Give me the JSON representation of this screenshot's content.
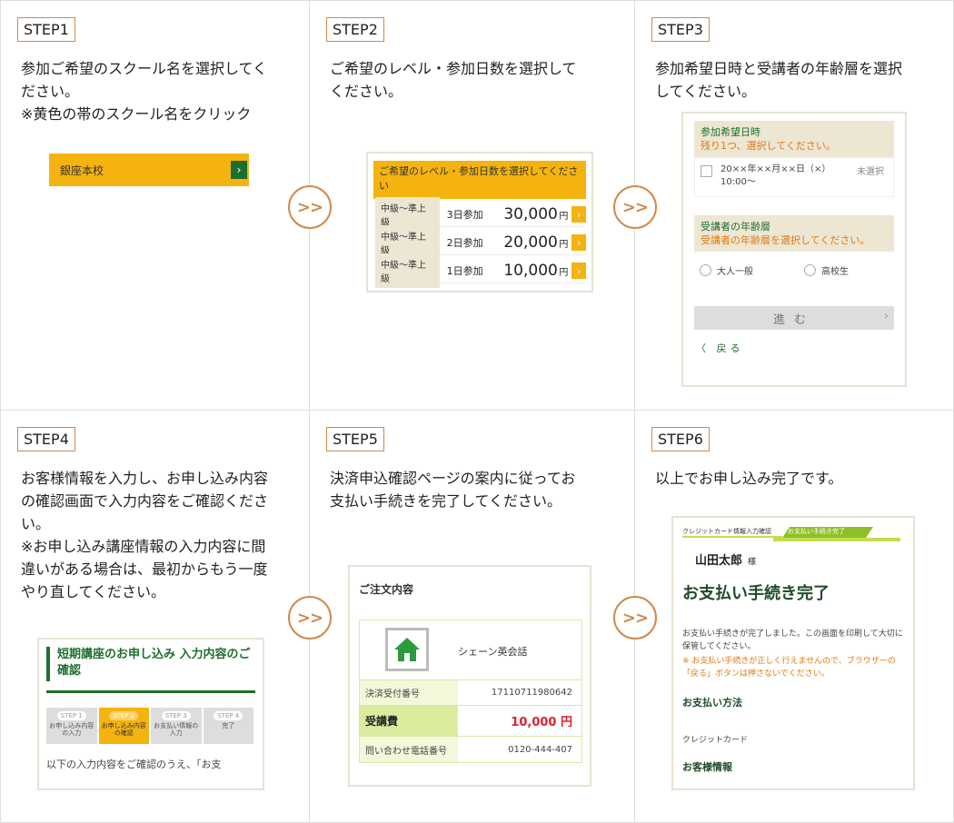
{
  "steps": [
    {
      "tag": "STEP1",
      "desc": [
        "参加ご希望のスクール名を選択してく",
        "ださい。",
        "※黄色の帯のスクール名をクリック"
      ]
    },
    {
      "tag": "STEP2",
      "desc": [
        "ご希望のレベル・参加日数を選択して",
        "ください。"
      ]
    },
    {
      "tag": "STEP3",
      "desc": [
        "参加希望日時と受講者の年齢層を選択",
        "してください。"
      ]
    },
    {
      "tag": "STEP4",
      "desc": [
        "お客様情報を入力し、お申し込み内容",
        "の確認画面で入力内容をご確認くださ",
        "い。",
        "※お申し込み講座情報の入力内容に間",
        "違いがある場合は、最初からもう一度",
        "やり直してください。"
      ]
    },
    {
      "tag": "STEP5",
      "desc": [
        "決済申込確認ページの案内に従ってお",
        "支払い手続きを完了してください。"
      ]
    },
    {
      "tag": "STEP6",
      "desc": [
        "以上でお申し込み完了です。"
      ]
    }
  ],
  "arrow_label": ">>",
  "step1": {
    "school_name": "銀座本校",
    "go": "›"
  },
  "step2": {
    "header": "ご希望のレベル・参加日数を選択してください",
    "rows": [
      {
        "level": "中級〜準上級",
        "days": "3日参加",
        "price": "30,000",
        "yen": "円",
        "go": "›"
      },
      {
        "level": "中級〜準上級",
        "days": "2日参加",
        "price": "20,000",
        "yen": "円",
        "go": "›"
      },
      {
        "level": "中級〜準上級",
        "days": "1日参加",
        "price": "10,000",
        "yen": "円",
        "go": "›"
      }
    ]
  },
  "step3": {
    "date_title": "参加希望日時",
    "date_remaining": "残り1つ、選択してください。",
    "date_value": "20××年××月××日（×）",
    "time_value": "10:00〜",
    "date_status": "未選択",
    "age_title": "受講者の年齢層",
    "age_prompt": "受講者の年齢層を選択してください。",
    "age_options": [
      "大人一般",
      "高校生"
    ],
    "next_button": "進む",
    "next_chevron": "›",
    "back_link": "〈 戻る"
  },
  "step4": {
    "title": "短期講座のお申し込み 入力内容のご確認",
    "steps": [
      {
        "n": "STEP 1",
        "label": "お申し込み内容の入力"
      },
      {
        "n": "STEP 2",
        "label": "お申し込み内容の確認"
      },
      {
        "n": "STEP 3",
        "label": "お支払い情報の入力"
      },
      {
        "n": "STEP 4",
        "label": "完了"
      }
    ],
    "text": "以下の入力内容をご確認のうえ、「お支"
  },
  "step5": {
    "title": "ご注文内容",
    "shop_name": "シェーン英会話",
    "rows": [
      {
        "key": "決済受付番号",
        "value": "17110711980642"
      },
      {
        "key": "受講費",
        "value": "10,000 円"
      },
      {
        "key": "問い合わせ電話番号",
        "value": "0120-444-407"
      }
    ]
  },
  "step6": {
    "band_left": "クレジットカード情報入力確認",
    "band_right": "お支払い手続き完了",
    "name": "山田太郎",
    "honorific": "様",
    "done_title": "お支払い手続き完了",
    "message": "お支払い手続きが完了しました。この画面を印刷して大切に保管してください。",
    "warning": "※ お支払い手続きが正しく行えませんので、ブラウザーの「戻る」ボタンは押さないでください。",
    "method_heading": "お支払い方法",
    "method_value": "クレジットカード",
    "customer_heading": "お客様情報"
  },
  "colors": {
    "accent_orange": "#f5b310",
    "brand_green": "#1f6e2e",
    "tag_border": "#d08a4c",
    "price_red": "#e0202b"
  }
}
